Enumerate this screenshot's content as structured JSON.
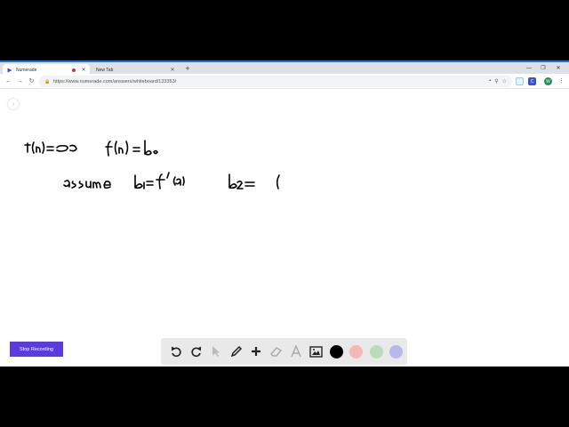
{
  "tabs": [
    {
      "label": "Numerade",
      "active": true
    },
    {
      "label": "New Tab",
      "active": false
    }
  ],
  "address_bar": {
    "url": "https://www.numerade.com/answers/whiteboard/133353/"
  },
  "extensions": [
    {
      "label": "C",
      "color": "#3b55c8"
    },
    {
      "label": "W",
      "color": "#1e8e5a"
    }
  ],
  "board": {
    "page_indicator": "1",
    "stop_recording_label": "Stop Recording"
  },
  "toolbox": {
    "colors": [
      "#000000",
      "#f3b8b8",
      "#b9dcb9",
      "#b8b8ec"
    ]
  }
}
